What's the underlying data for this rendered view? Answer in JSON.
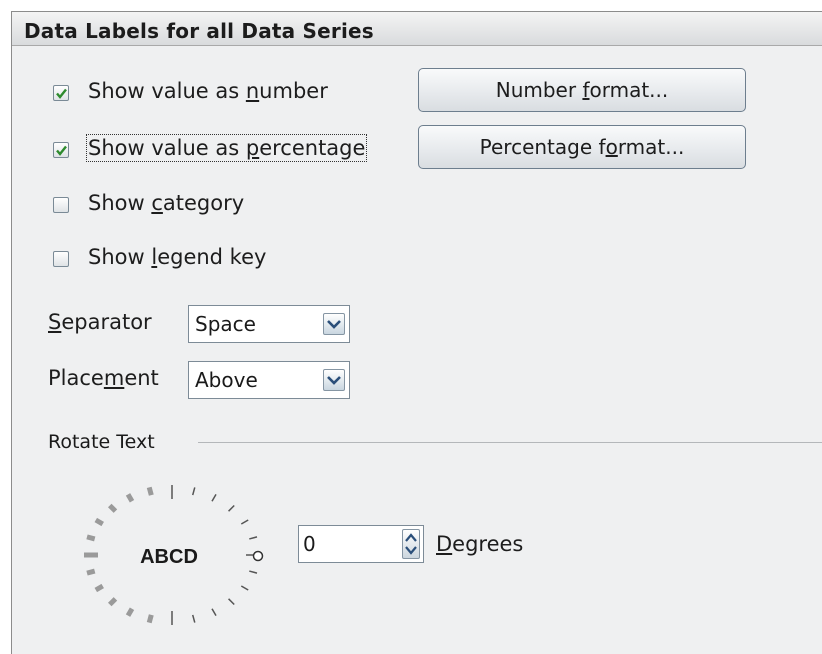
{
  "dialog": {
    "title": "Data Labels for all Data Series"
  },
  "options": {
    "show_number": {
      "label_pre": "Show value as ",
      "label_key": "n",
      "label_post": "umber",
      "checked": true
    },
    "show_percentage": {
      "label_pre": "Show value as ",
      "label_key": "p",
      "label_post": "ercentage",
      "checked": true
    },
    "show_category": {
      "label_pre": "Show ",
      "label_key": "c",
      "label_post": "ategory",
      "checked": false
    },
    "show_legend_key": {
      "label_pre": "Show ",
      "label_key": "l",
      "label_post": "egend key",
      "checked": false
    }
  },
  "buttons": {
    "number_format": {
      "pre": "Number ",
      "key": "f",
      "post": "ormat..."
    },
    "percentage_format": {
      "pre": "Percentage f",
      "key": "o",
      "post": "rmat..."
    }
  },
  "separator": {
    "label_key": "S",
    "label_post": "eparator",
    "value": "Space"
  },
  "placement": {
    "label_pre": "Place",
    "label_key": "m",
    "label_post": "ent",
    "value": "Above"
  },
  "rotate": {
    "section_label": "Rotate Text",
    "dial_text": "ABCD",
    "degrees_value": "0",
    "degrees_label_key": "D",
    "degrees_label_post": "egrees"
  },
  "colors": {
    "check": "#2e8b2e",
    "frame_bg": "#eff0f1"
  }
}
